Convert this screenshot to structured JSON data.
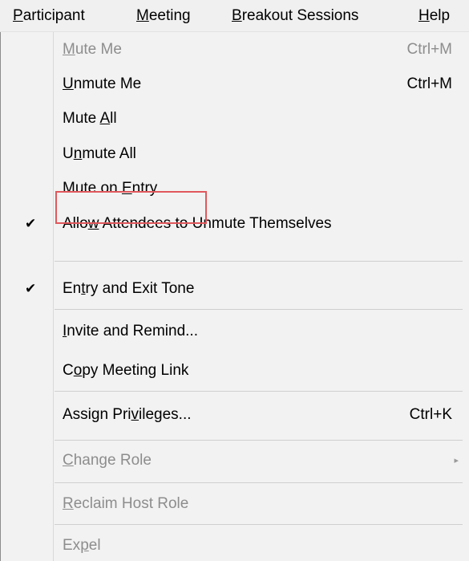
{
  "menubar": {
    "items": [
      {
        "label": "Participant",
        "underline_index": 0
      },
      {
        "label": "Meeting",
        "underline_index": 0
      },
      {
        "label": "Breakout Sessions",
        "underline_index": 0
      },
      {
        "label": "Help",
        "underline_index": 0
      }
    ]
  },
  "dropdown": {
    "items": [
      {
        "label": "Mute Me",
        "shortcut": "Ctrl+M",
        "enabled": false,
        "checked": false
      },
      {
        "label": "Unmute Me",
        "shortcut": "Ctrl+M",
        "enabled": true,
        "checked": false
      },
      {
        "label": "Mute All",
        "shortcut": "",
        "enabled": true,
        "checked": false
      },
      {
        "label": "Unmute All",
        "shortcut": "",
        "enabled": true,
        "checked": false
      },
      {
        "label": "Mute on Entry",
        "shortcut": "",
        "enabled": true,
        "checked": false,
        "highlighted": true
      },
      {
        "label": "Allow Attendees to Unmute Themselves",
        "shortcut": "",
        "enabled": true,
        "checked": true
      },
      {
        "label": "Entry and Exit Tone",
        "shortcut": "",
        "enabled": true,
        "checked": true
      },
      {
        "label": "Invite and Remind...",
        "shortcut": "",
        "enabled": true,
        "checked": false
      },
      {
        "label": "Copy Meeting Link",
        "shortcut": "",
        "enabled": true,
        "checked": false
      },
      {
        "label": "Assign Privileges...",
        "shortcut": "Ctrl+K",
        "enabled": true,
        "checked": false
      },
      {
        "label": "Change Role",
        "shortcut": "",
        "enabled": false,
        "checked": false,
        "submenu": true
      },
      {
        "label": "Reclaim Host Role",
        "shortcut": "",
        "enabled": false,
        "checked": false
      },
      {
        "label": "Expel",
        "shortcut": "",
        "enabled": false,
        "checked": false
      }
    ],
    "check_glyph": "✔",
    "submenu_glyph": "▸"
  },
  "colors": {
    "menu_background": "#f2f2f2",
    "disabled_text": "#8d8d8d",
    "highlight_border": "#e0585c"
  }
}
